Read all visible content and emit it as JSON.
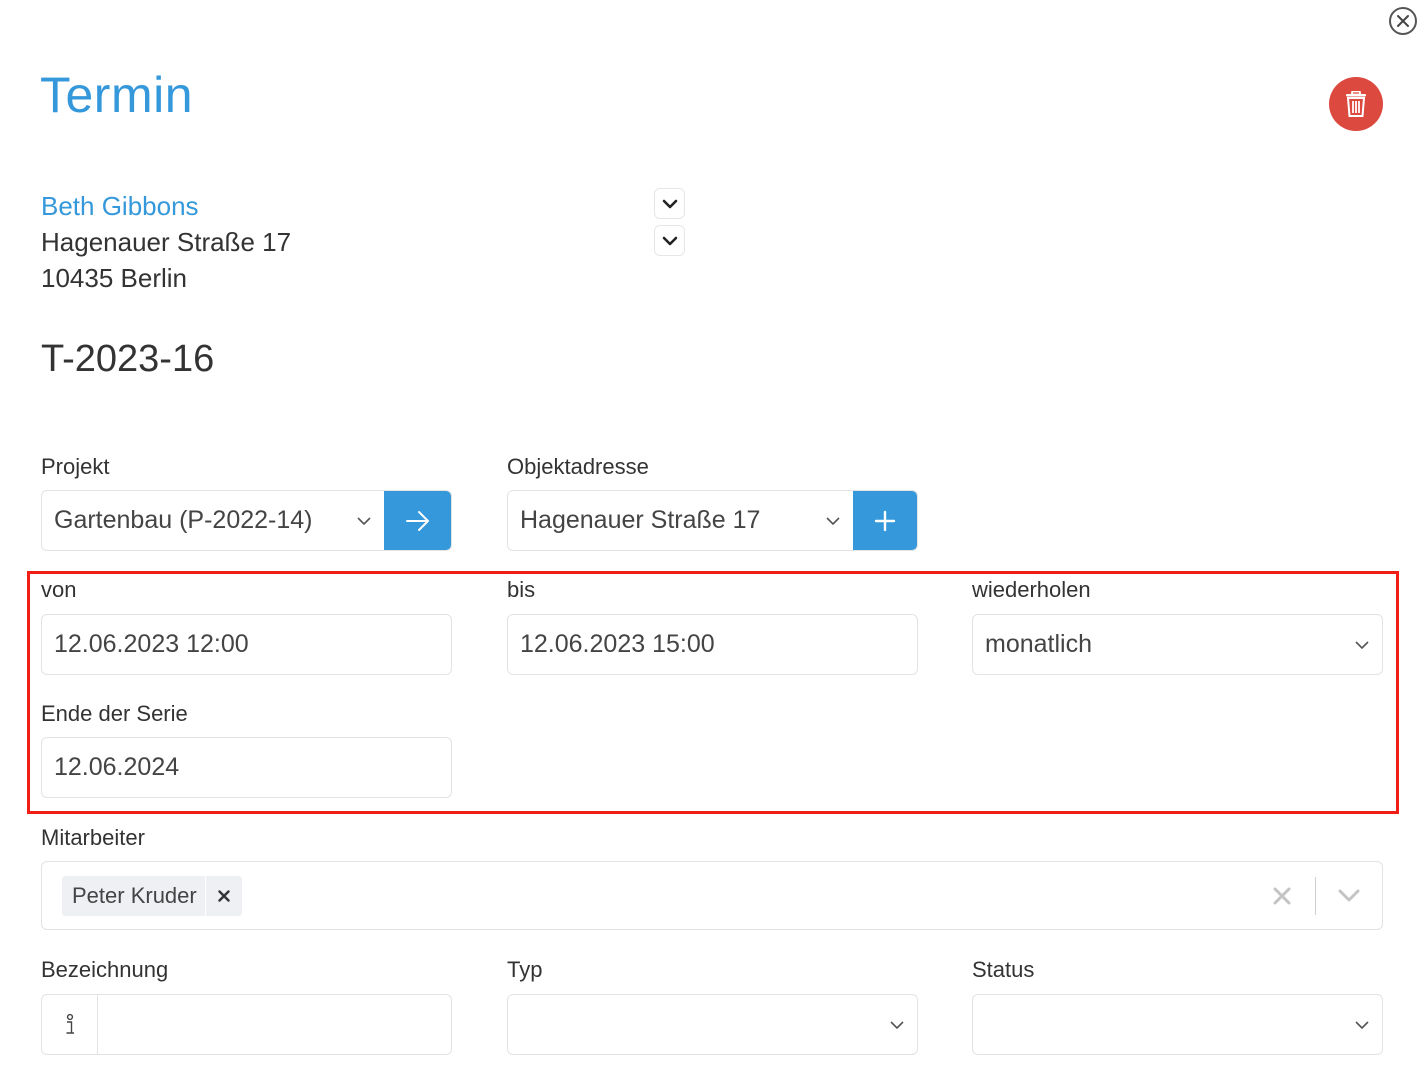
{
  "title": "Termin",
  "customer": {
    "name": "Beth Gibbons",
    "street": "Hagenauer Straße 17",
    "city": "10435 Berlin"
  },
  "appointment_number": "T-2023-16",
  "project": {
    "label": "Projekt",
    "value": "Gartenbau (P-2022-14)"
  },
  "object_address": {
    "label": "Objektadresse",
    "value": "Hagenauer Straße 17"
  },
  "from": {
    "label": "von",
    "value": "12.06.2023 12:00"
  },
  "to": {
    "label": "bis",
    "value": "12.06.2023 15:00"
  },
  "repeat": {
    "label": "wiederholen",
    "value": "monatlich"
  },
  "series_end": {
    "label": "Ende der Serie",
    "value": "12.06.2024"
  },
  "employees": {
    "label": "Mitarbeiter",
    "selected": [
      "Peter Kruder"
    ]
  },
  "designation": {
    "label": "Bezeichnung",
    "value": ""
  },
  "type": {
    "label": "Typ",
    "value": ""
  },
  "status": {
    "label": "Status",
    "value": ""
  },
  "colors": {
    "accent": "#3498db",
    "danger": "#dc4a3f",
    "highlight": "#f01e14"
  }
}
